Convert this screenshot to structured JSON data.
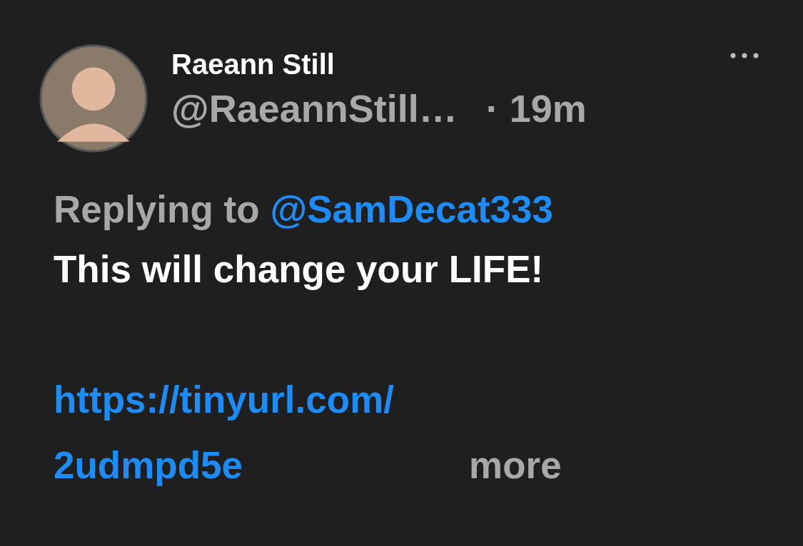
{
  "post": {
    "author": "Raeann Still",
    "handle": "@RaeannStill…",
    "time": "· 19m",
    "replying_label": "Replying to",
    "reply_to": "@SamDecat333",
    "text": "This will change your LIFE!",
    "link_lines": [
      "https://tinyurl.com/",
      "2udmpd5e"
    ],
    "more": "more"
  }
}
